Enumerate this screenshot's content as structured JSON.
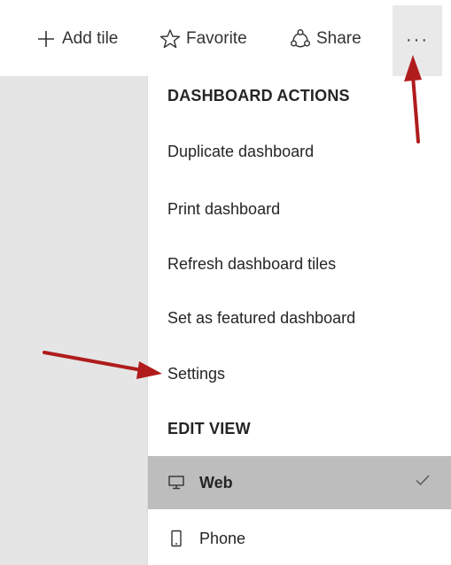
{
  "toolbar": {
    "add_tile_label": "Add tile",
    "favorite_label": "Favorite",
    "share_label": "Share",
    "more_label": "···"
  },
  "menu": {
    "dashboard_actions_heading": "DASHBOARD ACTIONS",
    "dashboard_actions": [
      {
        "label": "Duplicate dashboard"
      },
      {
        "label": "Print dashboard"
      },
      {
        "label": "Refresh dashboard tiles"
      },
      {
        "label": "Set as featured dashboard"
      },
      {
        "label": "Settings"
      }
    ],
    "edit_view_heading": "EDIT VIEW",
    "views": [
      {
        "label": "Web",
        "icon": "monitor-icon",
        "selected": true
      },
      {
        "label": "Phone",
        "icon": "phone-icon",
        "selected": false
      }
    ]
  },
  "annotations": {
    "arrow_color": "#b01c1c"
  }
}
